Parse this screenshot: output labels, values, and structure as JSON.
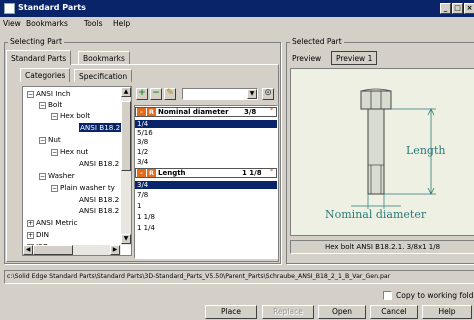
{
  "window": {
    "title": "Standard Parts"
  },
  "menu": [
    "View",
    "Bookmarks",
    "Tools",
    "Help"
  ],
  "selecting": {
    "group_title": "Selecting Part",
    "tabs": [
      "Standard Parts",
      "Bookmarks"
    ],
    "subtabs": [
      "Categories",
      "Specification"
    ],
    "tree": [
      {
        "label": "ANSI Inch",
        "box": "−"
      },
      {
        "label": "Bolt",
        "box": "−"
      },
      {
        "label": "Hex bolt",
        "box": "−"
      },
      {
        "label": "ANSI B18.2",
        "box": ""
      },
      {
        "label": "Nut",
        "box": "−"
      },
      {
        "label": "Hex nut",
        "box": "−"
      },
      {
        "label": "ANSI B18.2",
        "box": ""
      },
      {
        "label": "Washer",
        "box": "−"
      },
      {
        "label": "Plain washer ty",
        "box": "−"
      },
      {
        "label": "ANSI B18.2",
        "box": ""
      },
      {
        "label": "ANSI B18.2",
        "box": ""
      },
      {
        "label": "ANSI Metric",
        "box": "+"
      },
      {
        "label": "DIN",
        "box": "+"
      },
      {
        "label": "ISO",
        "box": "+"
      }
    ]
  },
  "params": {
    "h1_btns": [
      "-",
      "R"
    ],
    "h1_label": "Nominal diameter",
    "h1_value": "3/8",
    "list1": [
      "1/4",
      "5/16",
      "3/8",
      "1/2",
      "3/4"
    ],
    "h2_btns": [
      "-",
      "R"
    ],
    "h2_label": "Length",
    "h2_value": "1 1/8",
    "list2": [
      "3/4",
      "7/8",
      "1",
      "1 1/8",
      "1 1/4"
    ]
  },
  "selected": {
    "group_title": "Selected Part",
    "preview_label": "Preview",
    "preview_tab": "Preview 1",
    "dim_length": "Length",
    "dim_diameter": "Nominal diameter",
    "caption": "Hex bolt ANSI B18.2.1. 3/8x1 1/8"
  },
  "path": "c:\\Solid Edge Standard Parts\\Standard Parts\\3D-Standard_Parts_V5.50\\Parent_Parts\\Schraube_ANSI_B18_2_1_B_Var_Gen.par",
  "copy_label": "Copy to working folder",
  "buttons": {
    "place": "Place",
    "replace": "Replace",
    "open": "Open",
    "cancel": "Cancel",
    "help": "Help"
  },
  "colors": {
    "titlebar": "#0a246a",
    "accent": "#e46b1b",
    "preview_bg": "#eef0e4",
    "dimension": "#2a7a77"
  }
}
